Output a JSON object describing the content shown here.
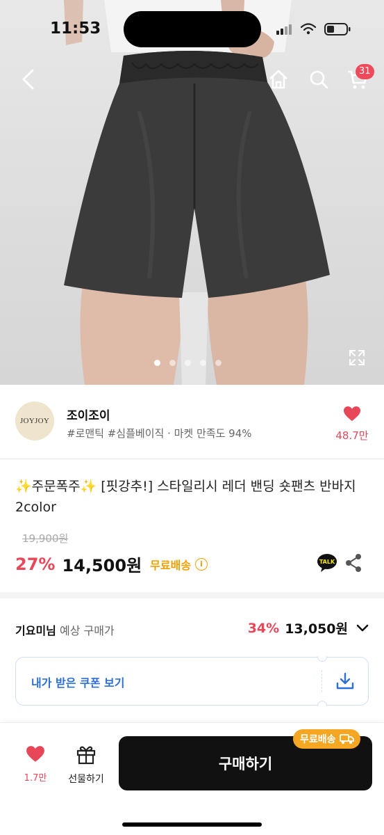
{
  "status": {
    "time": "11:53"
  },
  "header": {
    "cart_count": "31"
  },
  "carousel": {
    "total": 5,
    "active": 0
  },
  "store": {
    "logo_text": "JOYJOY",
    "name": "조이조이",
    "tags": "#로맨틱 #심플베이직 · 마켓 만족도 94%",
    "likes": "48.7만"
  },
  "product": {
    "title": "✨주문폭주✨ [핏강추!] 스타일리시 레더 밴딩 숏팬츠 반바지 2color",
    "original_price": "19,900원",
    "discount": "27%",
    "price": "14,500원",
    "shipping": "무료배송"
  },
  "expected": {
    "user": "기요미님",
    "label": "예상 구매가",
    "discount": "34%",
    "price": "13,050원"
  },
  "coupon": {
    "label": "내가 받은 쿠폰 보기"
  },
  "bottom": {
    "likes": "1.7만",
    "gift_label": "선물하기",
    "buy_label": "구매하기",
    "buy_badge": "무료배송"
  },
  "colors": {
    "accent_red": "#e8475a",
    "shipping_orange": "#f0a000",
    "coupon_blue": "#2d6fd6",
    "badge_orange": "#f5a623"
  }
}
